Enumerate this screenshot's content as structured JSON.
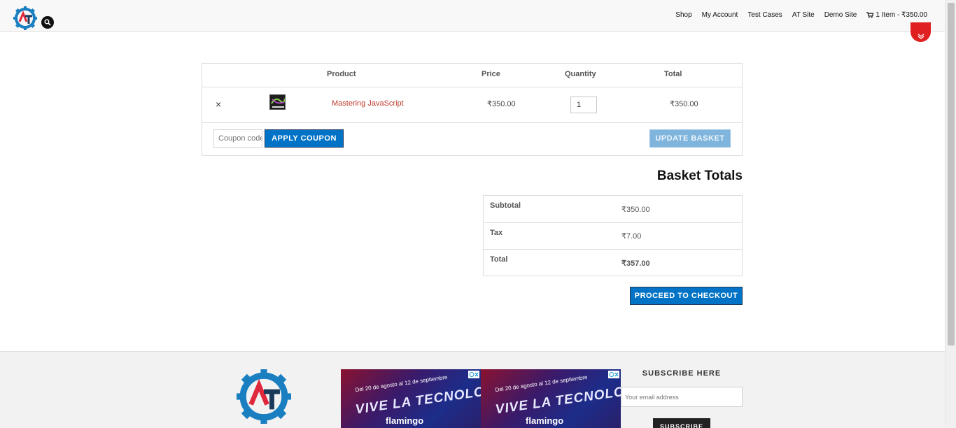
{
  "header": {
    "logo_letters": "AT",
    "nav": [
      {
        "label": "Shop"
      },
      {
        "label": "My Account"
      },
      {
        "label": "Test Cases"
      },
      {
        "label": "AT Site"
      },
      {
        "label": "Demo Site"
      }
    ],
    "cart_label": "1 Item - ₹350.00"
  },
  "cart": {
    "headers": {
      "product": "Product",
      "price": "Price",
      "quantity": "Quantity",
      "total": "Total"
    },
    "items": [
      {
        "name": "Mastering JavaScript",
        "price": "₹350.00",
        "quantity": "1",
        "total": "₹350.00"
      }
    ],
    "remove_symbol": "×",
    "coupon_placeholder": "Coupon code",
    "apply_coupon_label": "APPLY COUPON",
    "update_basket_label": "UPDATE BASKET"
  },
  "totals": {
    "title": "Basket Totals",
    "rows": [
      {
        "label": "Subtotal",
        "value": "₹350.00"
      },
      {
        "label": "Tax",
        "value": "₹7.00"
      },
      {
        "label": "Total",
        "value": "₹357.00"
      }
    ],
    "checkout_label": "PROCEED TO CHECKOUT"
  },
  "footer": {
    "ad": {
      "date_text": "Del 20 de agosto al 12 de septiembre",
      "headline": "VIVE LA TECNOLOGÍA",
      "brand": "flamingo"
    },
    "subscribe_title": "SUBSCRIBE HERE",
    "email_placeholder": "Your email address",
    "subscribe_button": "SUBSCRIBE"
  },
  "colors": {
    "primary_button": "#0073c6",
    "disabled_button": "#7fb5dd",
    "product_link": "#c0392b",
    "logo_blue": "#1a7fc1",
    "logo_red": "#e0283c",
    "badge_red": "#e02020"
  }
}
